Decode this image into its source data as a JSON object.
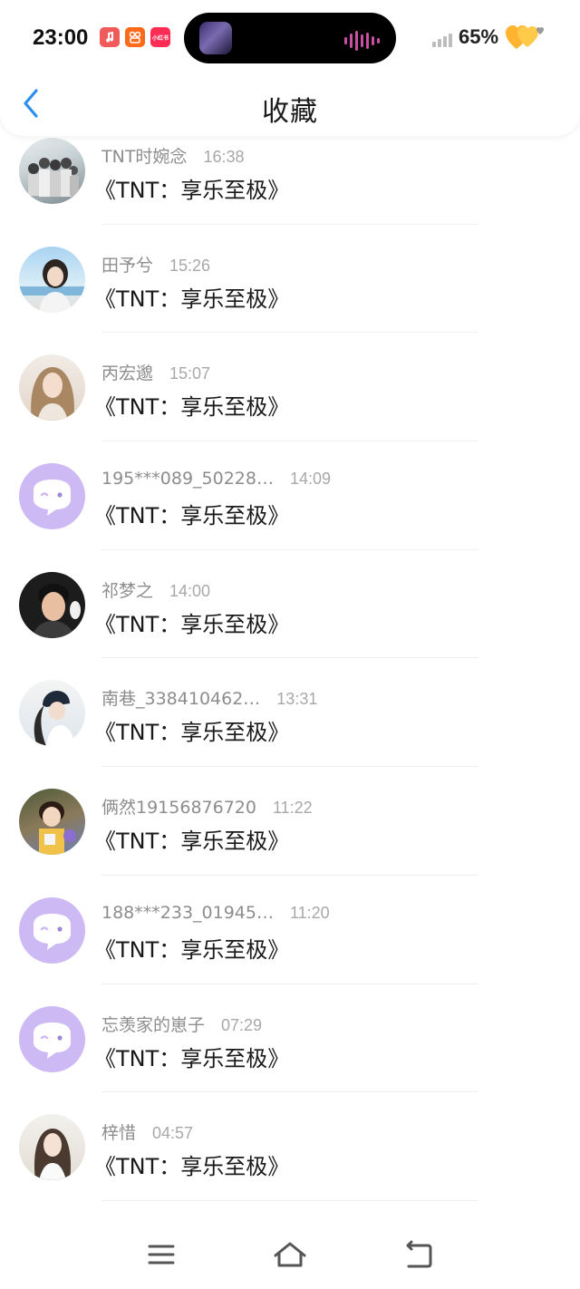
{
  "status_bar": {
    "time": "23:00",
    "notification_icons": [
      {
        "name": "music-app-icon",
        "color": "#f05a5a",
        "text": ""
      },
      {
        "name": "video-app-icon",
        "color": "#ff6a1a",
        "text": ""
      },
      {
        "name": "xiaohongshu-icon",
        "color": "#ff2d55",
        "text": "小红书"
      }
    ],
    "battery": "65%"
  },
  "header": {
    "title": "收藏",
    "back_icon": "chevron-left-icon",
    "accent_color": "#2b8ff0"
  },
  "items": [
    {
      "user": "TNT时婉念",
      "time": "16:38",
      "title": "《TNT：享乐至极》",
      "avatar": "photo"
    },
    {
      "user": "田予兮",
      "time": "15:26",
      "title": "《TNT：享乐至极》",
      "avatar": "photo"
    },
    {
      "user": "丙宏邈",
      "time": "15:07",
      "title": "《TNT：享乐至极》",
      "avatar": "photo"
    },
    {
      "user": "195***089_50228…",
      "time": "14:09",
      "title": "《TNT：享乐至极》",
      "avatar": "default"
    },
    {
      "user": "祁梦之",
      "time": "14:00",
      "title": "《TNT：享乐至极》",
      "avatar": "photo"
    },
    {
      "user": "南巷_338410462…",
      "time": "13:31",
      "title": "《TNT：享乐至极》",
      "avatar": "photo"
    },
    {
      "user": "俩然19156876720",
      "time": "11:22",
      "title": "《TNT：享乐至极》",
      "avatar": "photo"
    },
    {
      "user": "188***233_01945…",
      "time": "11:20",
      "title": "《TNT：享乐至极》",
      "avatar": "default"
    },
    {
      "user": "忘羡家的崽子",
      "time": "07:29",
      "title": "《TNT：享乐至极》",
      "avatar": "default"
    },
    {
      "user": "梓惜",
      "time": "04:57",
      "title": "《TNT：享乐至极》",
      "avatar": "photo"
    }
  ],
  "nav": {
    "menu_icon": "menu-icon",
    "home_icon": "home-icon",
    "back_icon": "back-icon"
  }
}
